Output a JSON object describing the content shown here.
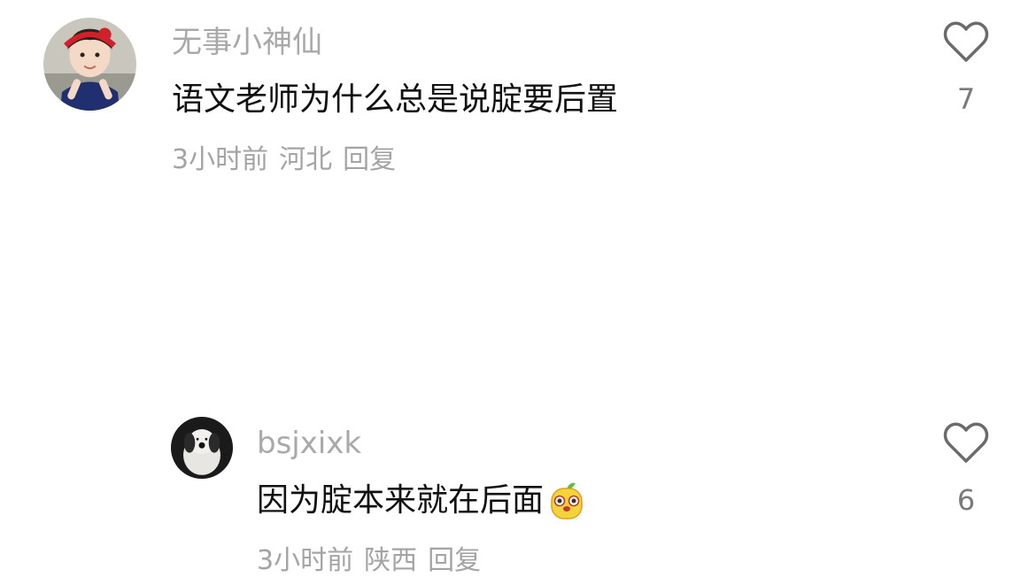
{
  "comments": [
    {
      "username": "无事小神仙",
      "text": "语文老师为什么总是说腚要后置",
      "time": "3小时前",
      "location": "河北",
      "reply_label": "回复",
      "likes": "7",
      "avatar_icon": "girl-avatar",
      "like_icon": "heart-outline-icon"
    },
    {
      "username": "bsjxixk",
      "text": "因为腚本来就在后面",
      "emoji": "yellow-sprout-emoji",
      "time": "3小时前",
      "location": "陕西",
      "reply_label": "回复",
      "likes": "6",
      "avatar_icon": "plush-dog-avatar",
      "like_icon": "heart-outline-icon"
    }
  ]
}
